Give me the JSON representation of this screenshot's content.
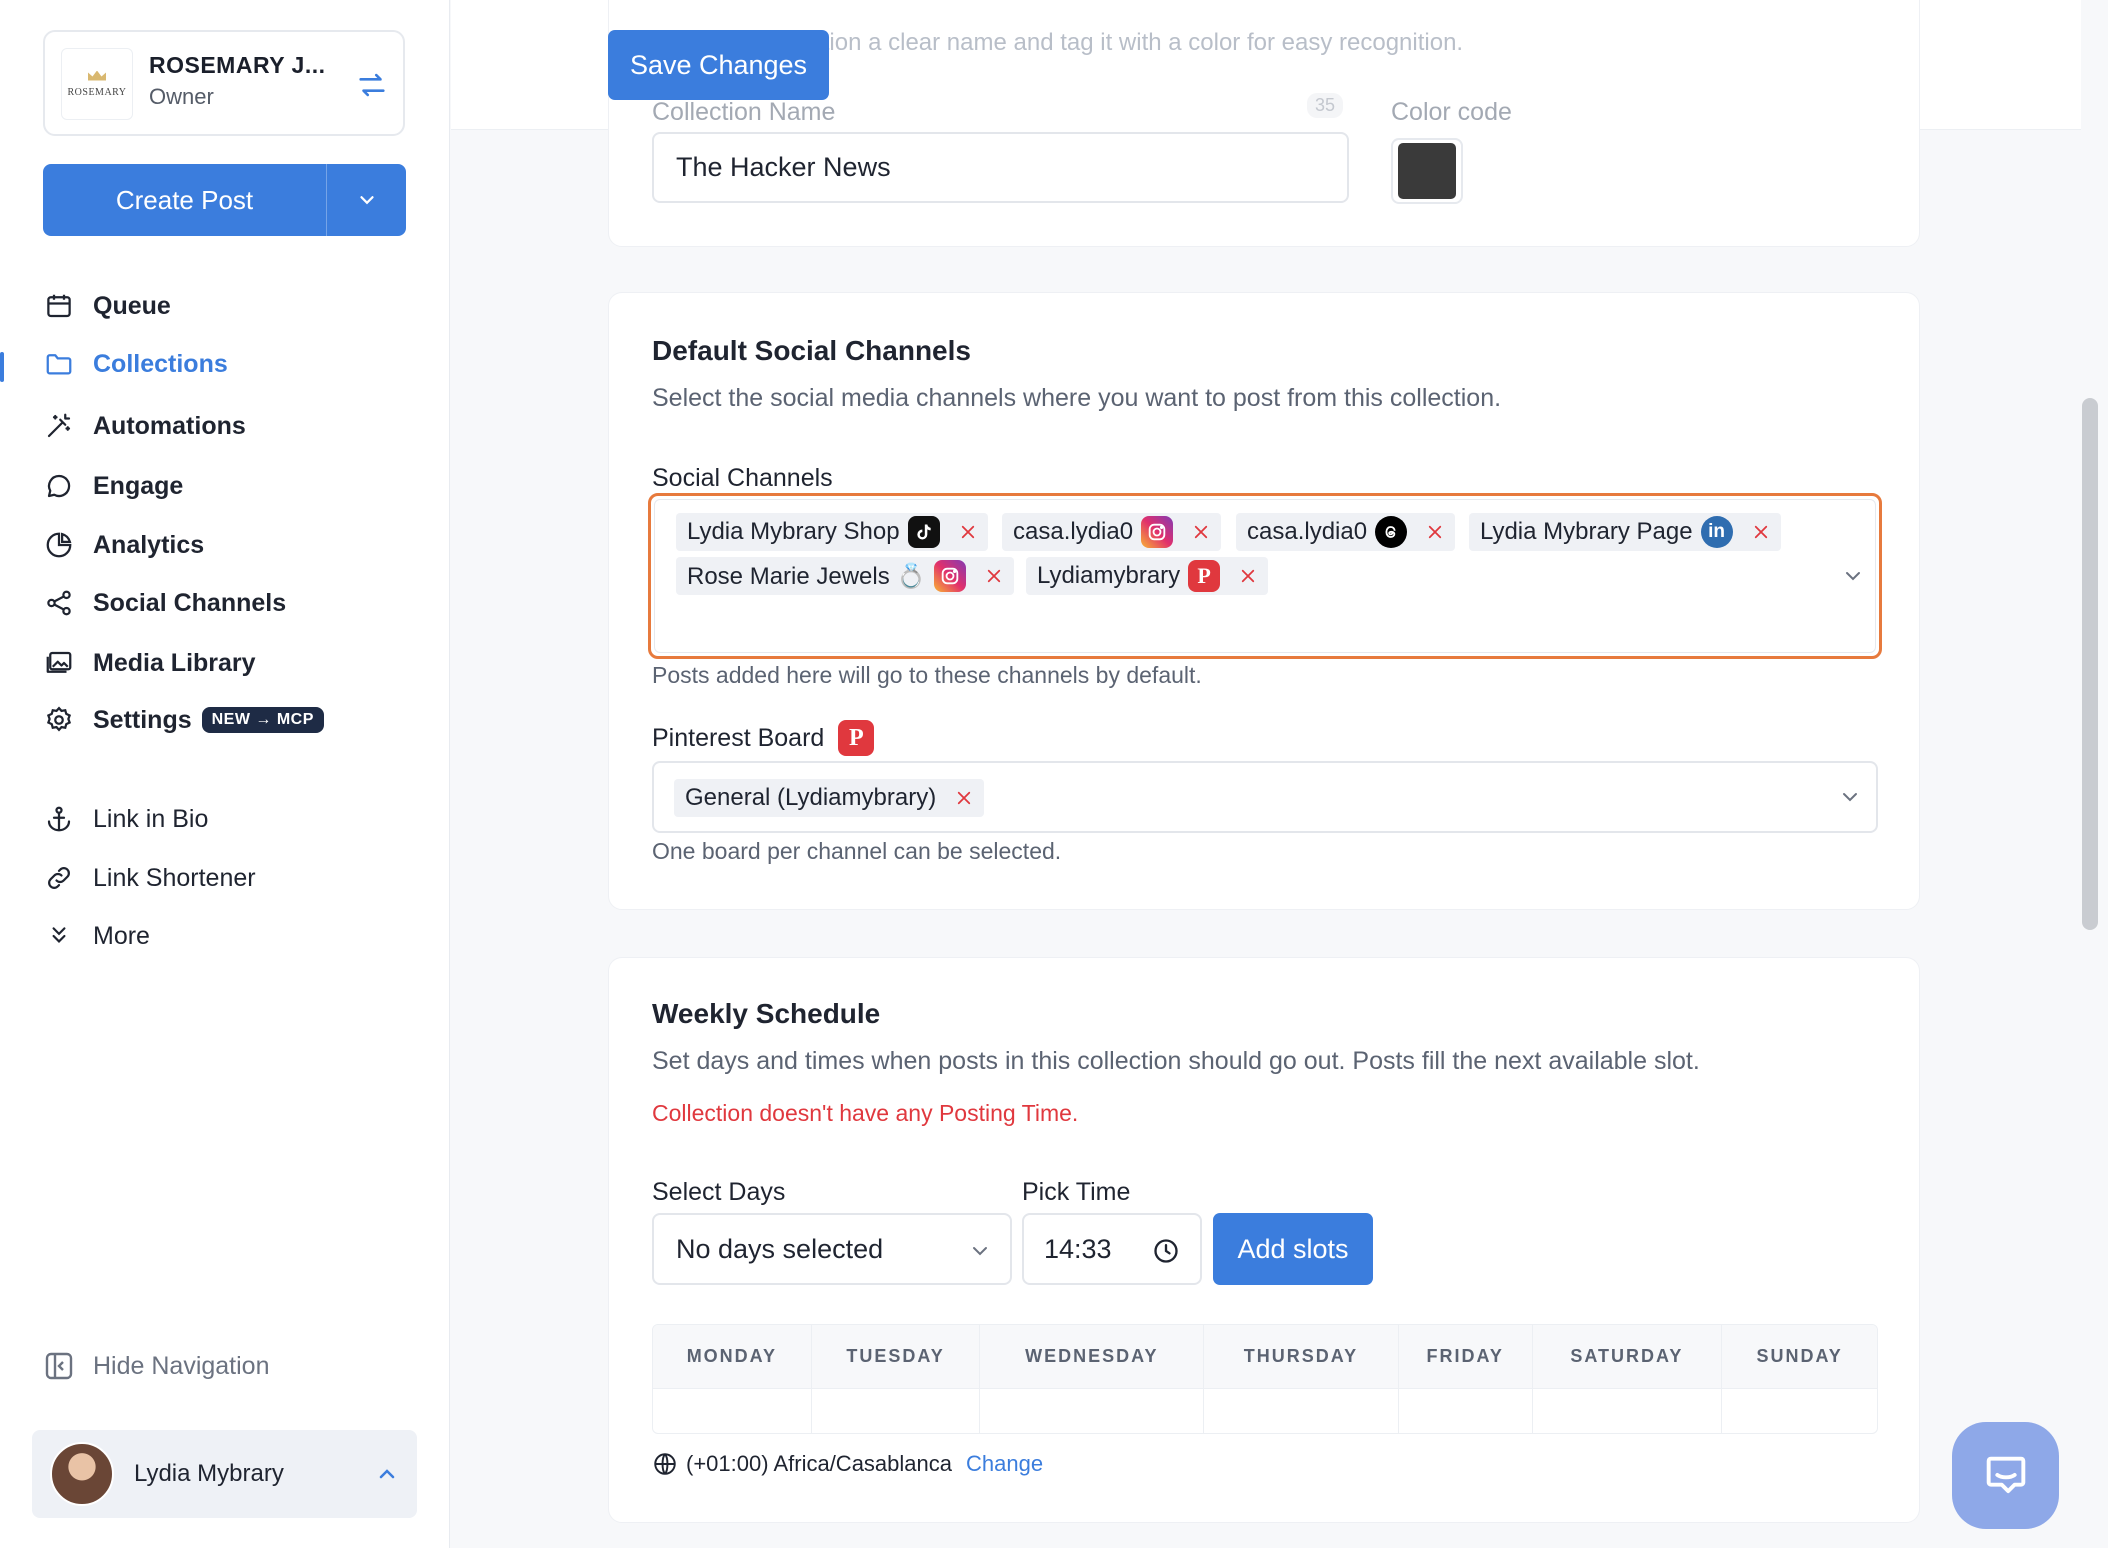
{
  "account": {
    "name": "ROSEMARY J...",
    "role": "Owner",
    "logo_text": "ROSEMARY"
  },
  "create_post": {
    "label": "Create Post"
  },
  "nav": {
    "queue": "Queue",
    "collections": "Collections",
    "automations": "Automations",
    "engage": "Engage",
    "analytics": "Analytics",
    "social_channels": "Social Channels",
    "media_library": "Media Library",
    "settings": "Settings",
    "settings_badge": "NEW → MCP",
    "link_in_bio": "Link in Bio",
    "link_shortener": "Link Shortener",
    "more": "More"
  },
  "hide_navigation": "Hide Navigation",
  "user": {
    "name": "Lydia Mybrary"
  },
  "save_button": "Save Changes",
  "collection": {
    "description": "Give your collection a clear name and tag it with a color for easy recognition.",
    "name_label": "Collection Name",
    "name_counter": "35",
    "name_value": "The Hacker News",
    "color_label": "Color code",
    "color_value": "#3a3a3a"
  },
  "default_channels": {
    "title": "Default Social Channels",
    "description": "Select the social media channels where you want to post from this collection.",
    "field_label": "Social Channels",
    "chips": [
      {
        "label": "Lydia Mybrary Shop",
        "icon": "tiktok-icon"
      },
      {
        "label": "casa.lydia0",
        "icon": "instagram-icon"
      },
      {
        "label": "casa.lydia0",
        "icon": "threads-icon"
      },
      {
        "label": "Lydia Mybrary Page",
        "icon": "linkedin-icon"
      },
      {
        "label": "Rose Marie Jewels 💍",
        "icon": "instagram-icon"
      },
      {
        "label": "Lydiamybrary",
        "icon": "pinterest-icon"
      }
    ],
    "help": "Posts added here will go to these channels by default.",
    "pinterest_label": "Pinterest Board",
    "pinterest_chip": "General (Lydiamybrary)",
    "pinterest_help": "One board per channel can be selected."
  },
  "weekly_schedule": {
    "title": "Weekly Schedule",
    "description": "Set days and times when posts in this collection should go out. Posts fill the next available slot.",
    "error": "Collection doesn't have any Posting Time.",
    "days_label": "Select Days",
    "days_value": "No days selected",
    "time_label": "Pick Time",
    "time_value": "14:33",
    "add_slots": "Add slots",
    "days": [
      "MONDAY",
      "TUESDAY",
      "WEDNESDAY",
      "THURSDAY",
      "FRIDAY",
      "SATURDAY",
      "SUNDAY"
    ],
    "timezone": "(+01:00) Africa/Casablanca",
    "change_link": "Change"
  },
  "colors": {
    "accent": "#3b7ddd",
    "error": "#e0383e",
    "focus_border": "#e77a3d"
  }
}
